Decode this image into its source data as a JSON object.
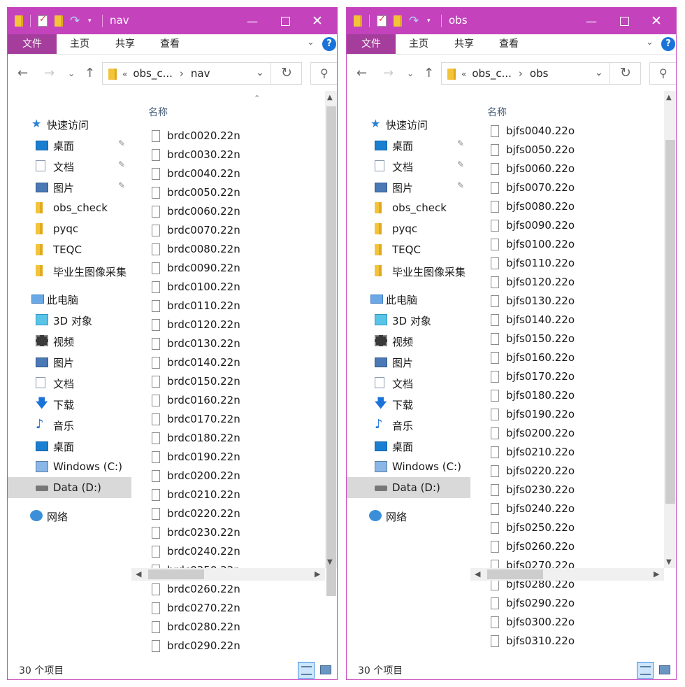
{
  "windows": [
    {
      "title": "nav",
      "ribbon_tabs": [
        "文件",
        "主页",
        "共享",
        "查看"
      ],
      "address": {
        "crumb1": "obs_c...",
        "sep": "›",
        "crumb2": "nav"
      },
      "nav": {
        "quick_access": "快速访问",
        "quick_items": [
          {
            "label": "桌面",
            "icon": "desktop-icon",
            "pinned": true
          },
          {
            "label": "文档",
            "icon": "document-icon",
            "pinned": true
          },
          {
            "label": "图片",
            "icon": "pictures-icon",
            "pinned": true
          },
          {
            "label": "obs_check",
            "icon": "folder-icon",
            "pinned": false
          },
          {
            "label": "pyqc",
            "icon": "folder-icon",
            "pinned": false
          },
          {
            "label": "TEQC",
            "icon": "folder-icon",
            "pinned": false
          },
          {
            "label": "毕业生图像采集",
            "icon": "folder-icon",
            "pinned": false
          }
        ],
        "this_pc": "此电脑",
        "pc_items": [
          {
            "label": "3D 对象",
            "icon": "3d-objects-icon"
          },
          {
            "label": "视频",
            "icon": "videos-icon"
          },
          {
            "label": "图片",
            "icon": "pictures-icon"
          },
          {
            "label": "文档",
            "icon": "document-icon"
          },
          {
            "label": "下载",
            "icon": "downloads-icon"
          },
          {
            "label": "音乐",
            "icon": "music-icon"
          },
          {
            "label": "桌面",
            "icon": "desktop-icon"
          },
          {
            "label": "Windows (C:)",
            "icon": "windows-drive-icon"
          },
          {
            "label": "Data (D:)",
            "icon": "drive-icon",
            "selected": true
          }
        ],
        "network": "网络"
      },
      "column_header": "名称",
      "files": [
        "brdc0020.22n",
        "brdc0030.22n",
        "brdc0040.22n",
        "brdc0050.22n",
        "brdc0060.22n",
        "brdc0070.22n",
        "brdc0080.22n",
        "brdc0090.22n",
        "brdc0100.22n",
        "brdc0110.22n",
        "brdc0120.22n",
        "brdc0130.22n",
        "brdc0140.22n",
        "brdc0150.22n",
        "brdc0160.22n",
        "brdc0170.22n",
        "brdc0180.22n",
        "brdc0190.22n",
        "brdc0200.22n",
        "brdc0210.22n",
        "brdc0220.22n",
        "brdc0230.22n",
        "brdc0240.22n",
        "brdc0250.22n",
        "brdc0260.22n",
        "brdc0270.22n",
        "brdc0280.22n",
        "brdc0290.22n"
      ],
      "status": "30 个项目",
      "colors": {
        "titlebar": "#c443bd",
        "file_tab": "#a43d9b"
      }
    },
    {
      "title": "obs",
      "ribbon_tabs": [
        "文件",
        "主页",
        "共享",
        "查看"
      ],
      "address": {
        "crumb1": "obs_c...",
        "sep": "›",
        "crumb2": "obs"
      },
      "nav": {
        "quick_access": "快速访问",
        "quick_items": [
          {
            "label": "桌面",
            "icon": "desktop-icon",
            "pinned": true
          },
          {
            "label": "文档",
            "icon": "document-icon",
            "pinned": true
          },
          {
            "label": "图片",
            "icon": "pictures-icon",
            "pinned": true
          },
          {
            "label": "obs_check",
            "icon": "folder-icon",
            "pinned": false
          },
          {
            "label": "pyqc",
            "icon": "folder-icon",
            "pinned": false
          },
          {
            "label": "TEQC",
            "icon": "folder-icon",
            "pinned": false
          },
          {
            "label": "毕业生图像采集",
            "icon": "folder-icon",
            "pinned": false
          }
        ],
        "this_pc": "此电脑",
        "pc_items": [
          {
            "label": "3D 对象",
            "icon": "3d-objects-icon"
          },
          {
            "label": "视频",
            "icon": "videos-icon"
          },
          {
            "label": "图片",
            "icon": "pictures-icon"
          },
          {
            "label": "文档",
            "icon": "document-icon"
          },
          {
            "label": "下载",
            "icon": "downloads-icon"
          },
          {
            "label": "音乐",
            "icon": "music-icon"
          },
          {
            "label": "桌面",
            "icon": "desktop-icon"
          },
          {
            "label": "Windows (C:)",
            "icon": "windows-drive-icon"
          },
          {
            "label": "Data (D:)",
            "icon": "drive-icon",
            "selected": true
          }
        ],
        "network": "网络"
      },
      "column_header": "名称",
      "files": [
        "bjfs0040.22o",
        "bjfs0050.22o",
        "bjfs0060.22o",
        "bjfs0070.22o",
        "bjfs0080.22o",
        "bjfs0090.22o",
        "bjfs0100.22o",
        "bjfs0110.22o",
        "bjfs0120.22o",
        "bjfs0130.22o",
        "bjfs0140.22o",
        "bjfs0150.22o",
        "bjfs0160.22o",
        "bjfs0170.22o",
        "bjfs0180.22o",
        "bjfs0190.22o",
        "bjfs0200.22o",
        "bjfs0210.22o",
        "bjfs0220.22o",
        "bjfs0230.22o",
        "bjfs0240.22o",
        "bjfs0250.22o",
        "bjfs0260.22o",
        "bjfs0270.22o",
        "bjfs0280.22o",
        "bjfs0290.22o",
        "bjfs0300.22o",
        "bjfs0310.22o"
      ],
      "status": "30 个项目",
      "colors": {
        "titlebar": "#c443bd",
        "file_tab": "#a43d9b"
      }
    }
  ]
}
